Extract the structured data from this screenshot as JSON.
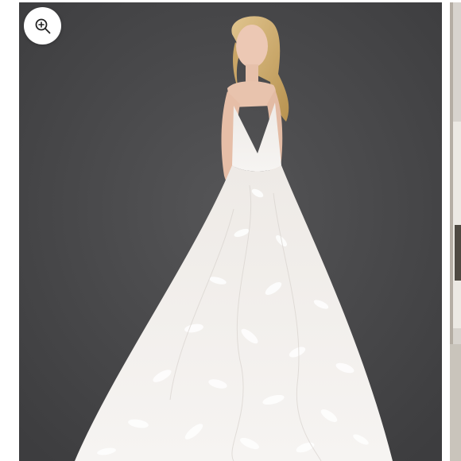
{
  "gallery": {
    "zoom_button": {
      "icon": "zoom-in-icon"
    },
    "main_image": {
      "subject": "wedding-gown-photo",
      "background_color": "#4a4a4c"
    },
    "next_image": {
      "subject": "next-gallery-photo-peek"
    }
  }
}
